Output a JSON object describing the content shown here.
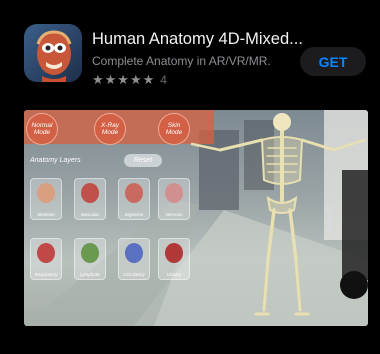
{
  "app": {
    "title": "Human Anatomy 4D-Mixed...",
    "subtitle": "Complete  Anatomy in AR/VR/MR.",
    "stars": "★★★★★",
    "rating_count": "4",
    "get_label": "GET"
  },
  "preview": {
    "modes": [
      {
        "label": "Normal\nMode"
      },
      {
        "label": "X-Ray\nMode"
      },
      {
        "label": "Skin\nMode"
      }
    ],
    "layers_label": "Anatomy Layers",
    "reset_label": "Reset",
    "layers": [
      {
        "label": "Skeleton",
        "color": "#d8a080"
      },
      {
        "label": "Muscular",
        "color": "#c0504a"
      },
      {
        "label": "Digestive",
        "color": "#c86a60"
      },
      {
        "label": "Nervous",
        "color": "#d09090"
      },
      {
        "label": "Respiratory",
        "color": "#c04848"
      },
      {
        "label": "Lymphatic",
        "color": "#6a9a50"
      },
      {
        "label": "Circulatory",
        "color": "#5a70c0"
      },
      {
        "label": "Urinary",
        "color": "#b03838"
      }
    ],
    "scale_label": "SCALE"
  },
  "colors": {
    "accent": "#0a84ff",
    "background": "#000000"
  }
}
